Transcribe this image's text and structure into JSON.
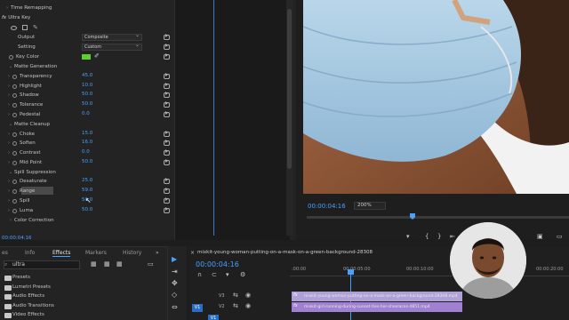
{
  "effect_controls": {
    "rows": {
      "time_remapping": "Time Remapping",
      "ultra_key": "Ultra Key",
      "output_label": "Output",
      "output_value": "Composite",
      "setting_label": "Setting",
      "setting_value": "Custom",
      "key_color_label": "Key Color",
      "matte_generation": "Matte Generation",
      "transparency": {
        "label": "Transparency",
        "value": "45.0"
      },
      "highlight": {
        "label": "Highlight",
        "value": "10.0"
      },
      "shadow": {
        "label": "Shadow",
        "value": "50.0"
      },
      "tolerance": {
        "label": "Tolerance",
        "value": "50.0"
      },
      "pedestal": {
        "label": "Pedestal",
        "value": "0.0"
      },
      "matte_cleanup": "Matte Cleanup",
      "choke": {
        "label": "Choke",
        "value": "15.0"
      },
      "soften": {
        "label": "Soften",
        "value": "16.0"
      },
      "contrast": {
        "label": "Contrast",
        "value": "0.0"
      },
      "mid_point": {
        "label": "Mid Point",
        "value": "50.0"
      },
      "spill_suppression": "Spill Suppression",
      "desaturate": {
        "label": "Desaturate",
        "value": "25.0"
      },
      "range": {
        "label": "Range",
        "value": "59.0"
      },
      "spill": {
        "label": "Spill",
        "value": "50.0"
      },
      "luma": {
        "label": "Luma",
        "value": "50.0"
      },
      "color_correction": "Color Correction"
    },
    "timecode": "00:00:04:16",
    "key_color": "#5fd02a"
  },
  "program_monitor": {
    "timecode": "00:00:04:16",
    "zoom": "200%"
  },
  "project_panel": {
    "tabs": [
      "es",
      "Info",
      "Effects",
      "Markers",
      "History"
    ],
    "search_value": "ultra",
    "folders": [
      "Presets",
      "Lumetri Presets",
      "Audio Effects",
      "Audio Transitions",
      "Video Effects"
    ]
  },
  "timeline": {
    "sequence_tab": "mixkit-young-woman-putting-on-a-mask-on-a-green-background-28308",
    "timecode": "00:00:04:16",
    "ruler_ticks": [
      ":00:00",
      "00:00:05:00",
      "00:00:10:00",
      "00:00:20:00"
    ],
    "tracks": [
      "V3",
      "V2",
      "V1"
    ],
    "clips": [
      {
        "label": "mixkit-young-woman-putting-on-a-mask-on-a-green-background-28308.mp4",
        "color": "#b0a0d8"
      },
      {
        "label": "mixkit-girl-running-during-sunset-ties-her-shoelaces-4851.mp4",
        "color": "#a080d0"
      }
    ]
  }
}
